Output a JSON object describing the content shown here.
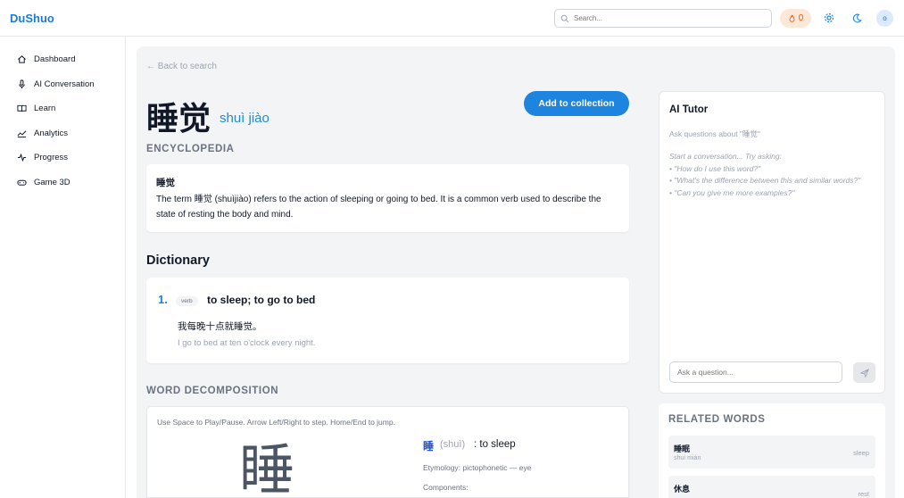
{
  "app": {
    "brand": "DuShuo"
  },
  "header": {
    "search_placeholder": "Search...",
    "streak_count": "0",
    "avatar_initial": "o"
  },
  "sidebar": {
    "items": [
      {
        "label": "Dashboard",
        "icon": "home-icon"
      },
      {
        "label": "AI Conversation",
        "icon": "microphone-icon"
      },
      {
        "label": "Learn",
        "icon": "book-icon"
      },
      {
        "label": "Analytics",
        "icon": "chart-icon"
      },
      {
        "label": "Progress",
        "icon": "activity-icon"
      },
      {
        "label": "Game 3D",
        "icon": "gamepad-icon"
      }
    ]
  },
  "word": {
    "back_label": "← Back to search",
    "headword": "睡觉",
    "pinyin": "shuì jiào",
    "add_button": "Add to collection"
  },
  "encyclopedia": {
    "label": "ENCYCLOPEDIA",
    "title": "睡觉",
    "text": "The term 睡觉 (shuìjiào) refers to the action of sleeping or going to bed. It is a common verb used to describe the state of resting the body and mind."
  },
  "dictionary": {
    "heading": "Dictionary",
    "senses": [
      {
        "number": "1.",
        "pos": "verb",
        "definition": "to sleep; to go to bed",
        "example_zh": "我每晚十点就睡觉。",
        "example_en": "I go to bed at ten o'clock every night."
      }
    ]
  },
  "decomposition": {
    "label": "WORD DECOMPOSITION",
    "hint": "Use Space to Play/Pause. Arrow Left/Right to step. Home/End to jump.",
    "character": "睡",
    "char_pinyin": "(shuì)",
    "char_meaning": ": to sleep",
    "etymology": "Etymology: pictophonetic — eye",
    "components_label": "Components:"
  },
  "tutor": {
    "title": "AI Tutor",
    "subtitle": "Ask questions about \"睡觉\"",
    "prompt_lines": [
      "Start a conversation... Try asking:",
      "• \"How do I use this word?\"",
      "• \"What's the difference between this and similar words?\"",
      "• \"Can you give me more examples?\""
    ],
    "input_placeholder": "Ask a question..."
  },
  "related": {
    "title": "RELATED WORDS",
    "items": [
      {
        "word": "睡眠",
        "pinyin": "shuì mián",
        "meaning": "sleep"
      },
      {
        "word": "休息",
        "pinyin": "",
        "meaning": "rest"
      }
    ]
  },
  "colors": {
    "brand": "#1d7bd8",
    "accent": "#1d84e0",
    "background": "#f3f4f6"
  }
}
